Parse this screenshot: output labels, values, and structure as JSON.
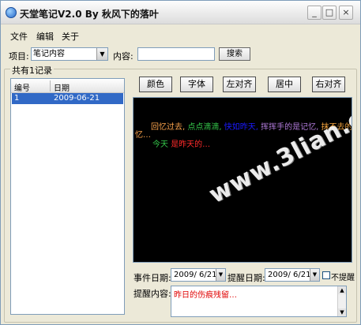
{
  "window": {
    "title": "天堂笔记V2.0  By 秋风下的落叶",
    "minimize": "_",
    "maximize": "□",
    "close": "×"
  },
  "menu": {
    "file": "文件",
    "edit": "编辑",
    "about": "关于"
  },
  "search": {
    "project_label": "项目:",
    "project_value": "笔记内容",
    "content_label": "内容:",
    "content_value": "",
    "search_button": "搜索"
  },
  "records": {
    "group_title": "共有1记录",
    "columns": [
      "编号",
      "日期"
    ],
    "rows": [
      {
        "id": "1",
        "date": "2009-06-21"
      }
    ]
  },
  "toolbar": {
    "color": "颜色",
    "font": "字体",
    "align_left": "左对齐",
    "align_center": "居中",
    "align_right": "右对齐"
  },
  "editor": {
    "line1": [
      "回忆过去,",
      "点点滴滴,",
      "快如昨天,",
      "挥挥手的是记忆,",
      "抹不去的是回"
    ],
    "line2": "忆…",
    "line3": [
      "今天",
      "是昨天的…"
    ],
    "watermark": "www.3lian.com"
  },
  "dates": {
    "event_label": "事件日期:",
    "event_value": "2009/ 6/21",
    "remind_label": "提醒日期:",
    "remind_value": "2009/ 6/21",
    "no_remind_label": "不提醒",
    "no_remind_checked": false
  },
  "reminder": {
    "label": "提醒内容:",
    "text": "昨日的伤痕残留…"
  }
}
